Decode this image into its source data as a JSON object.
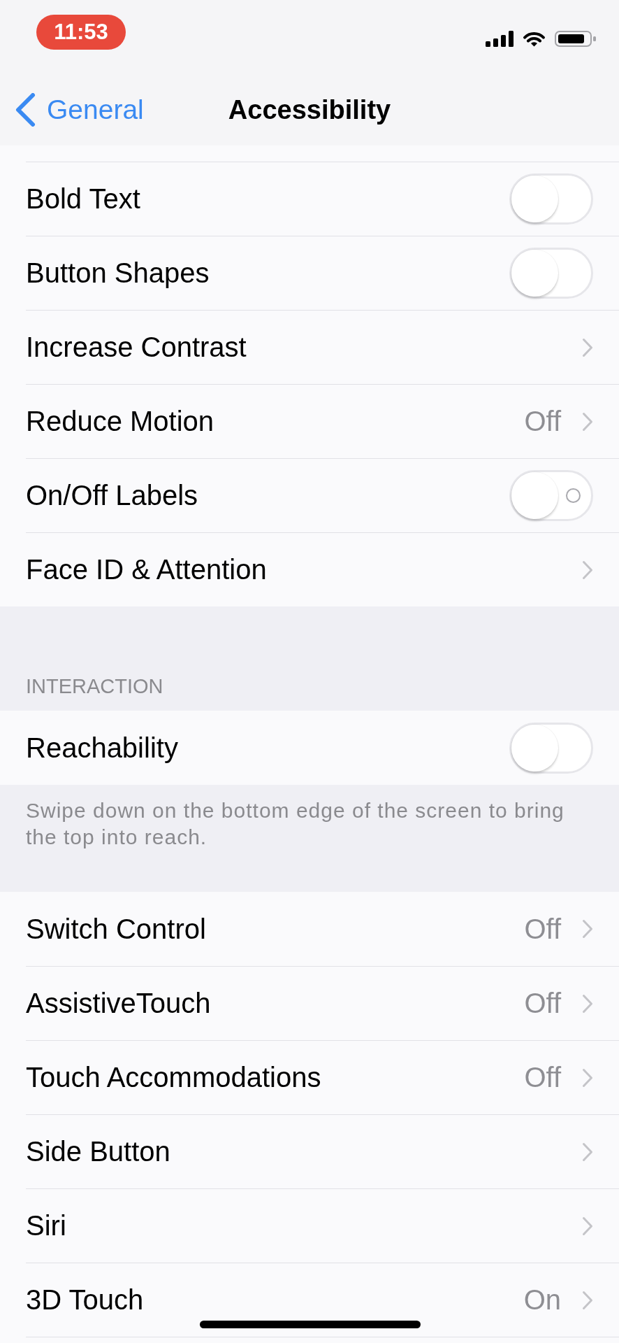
{
  "status_bar": {
    "time": "11:53"
  },
  "nav_bar": {
    "back_label": "General",
    "title": "Accessibility"
  },
  "sections": [
    {
      "rows": [
        {
          "kind": "toggle",
          "label": "Bold Text",
          "on": false,
          "off_symbol": false
        },
        {
          "kind": "toggle",
          "label": "Button Shapes",
          "on": false,
          "off_symbol": false
        },
        {
          "kind": "disclosure",
          "label": "Increase Contrast"
        },
        {
          "kind": "disclosure",
          "label": "Reduce Motion",
          "value": "Off"
        },
        {
          "kind": "toggle",
          "label": "On/Off Labels",
          "on": false,
          "off_symbol": true
        },
        {
          "kind": "disclosure",
          "label": "Face ID & Attention"
        }
      ]
    },
    {
      "header": "INTERACTION",
      "rows": [
        {
          "kind": "toggle",
          "label": "Reachability",
          "on": false,
          "off_symbol": false
        }
      ],
      "footer": "Swipe down on the bottom edge of the screen to bring the top into reach."
    },
    {
      "rows": [
        {
          "kind": "disclosure",
          "label": "Switch Control",
          "value": "Off"
        },
        {
          "kind": "disclosure",
          "label": "AssistiveTouch",
          "value": "Off"
        },
        {
          "kind": "disclosure",
          "label": "Touch Accommodations",
          "value": "Off"
        },
        {
          "kind": "disclosure",
          "label": "Side Button"
        },
        {
          "kind": "disclosure",
          "label": "Siri"
        },
        {
          "kind": "disclosure",
          "label": "3D Touch",
          "value": "On"
        }
      ]
    }
  ]
}
